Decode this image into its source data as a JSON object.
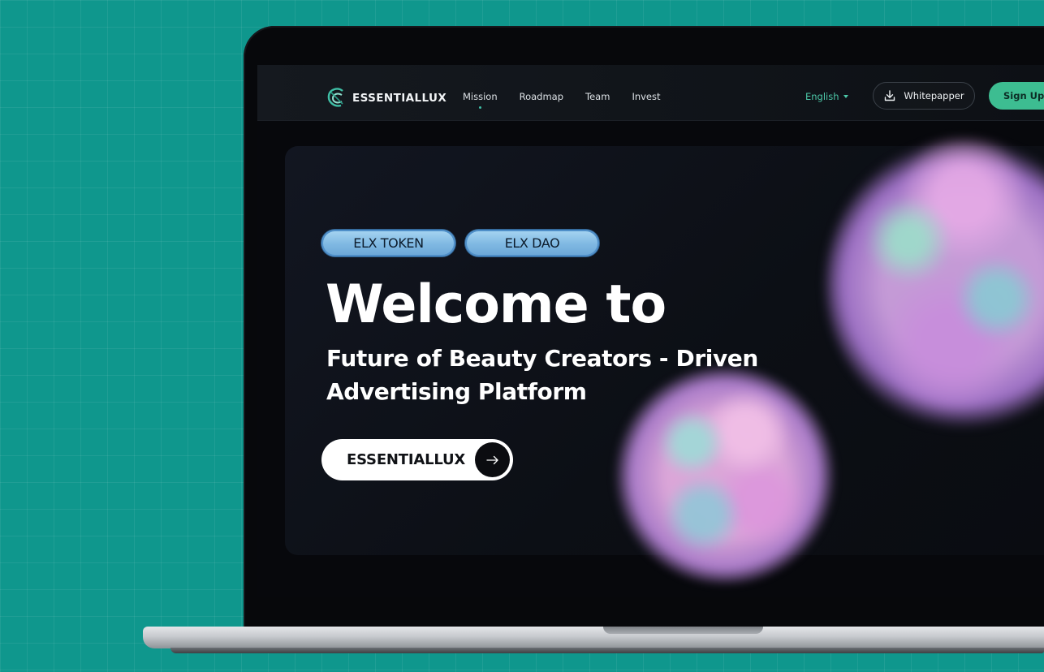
{
  "nav": {
    "brand": "ESSENTIALLUX",
    "links": [
      {
        "label": "Mission",
        "active": true
      },
      {
        "label": "Roadmap"
      },
      {
        "label": "Team"
      },
      {
        "label": "Invest"
      }
    ],
    "language": "English",
    "whitepaper_label": "Whitepapper",
    "signup_label": "Sign Up"
  },
  "hero": {
    "tags": [
      "ELX TOKEN",
      "ELX DAO"
    ],
    "title": "Welcome to",
    "subtitle_line1": "Future of Beauty Creators - Driven",
    "subtitle_line2": "Advertising Platform",
    "cta_label": "ESSENTIALLUX"
  },
  "colors": {
    "background": "#0f978d",
    "accent": "#3dbd91",
    "language_text": "#4cc8a8",
    "tag_fill": "#8cc4ea",
    "screen": "#07080c"
  },
  "icons": {
    "logo": "essentiallux-logo-icon",
    "download": "download-icon",
    "caret": "caret-down-icon",
    "arrow": "arrow-right-icon"
  }
}
